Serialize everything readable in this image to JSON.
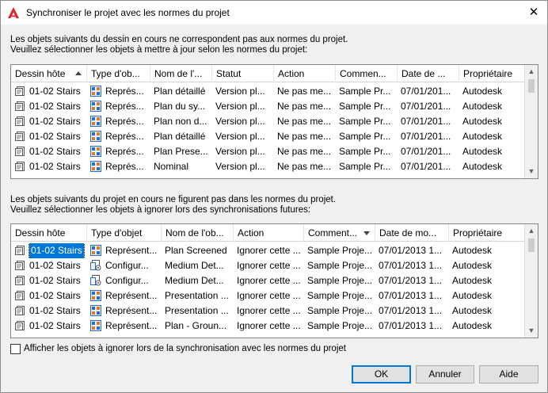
{
  "window": {
    "title": "Synchroniser le projet avec les normes du projet",
    "close_glyph": "✕"
  },
  "section1": {
    "line1": "Les objets suivants du dessin en cours ne correspondent pas aux normes du projet.",
    "line2": "Veuillez sélectionner les objets à mettre à jour selon les normes du projet:",
    "sort_column": "Dessin hôte",
    "sort_direction": "ascending",
    "columns": [
      "Dessin hôte",
      "Type d'ob...",
      "Nom de l'...",
      "Statut",
      "Action",
      "Commen...",
      "Date de ...",
      "Propriétaire"
    ],
    "rows": [
      [
        "01-02 Stairs",
        "Représ...",
        "Plan détaillé",
        "Version pl...",
        "Ne pas me...",
        "Sample Pr...",
        "07/01/201...",
        "Autodesk"
      ],
      [
        "01-02 Stairs",
        "Représ...",
        "Plan du sy...",
        "Version pl...",
        "Ne pas me...",
        "Sample Pr...",
        "07/01/201...",
        "Autodesk"
      ],
      [
        "01-02 Stairs",
        "Représ...",
        "Plan non d...",
        "Version pl...",
        "Ne pas me...",
        "Sample Pr...",
        "07/01/201...",
        "Autodesk"
      ],
      [
        "01-02 Stairs",
        "Représ...",
        "Plan détaillé",
        "Version pl...",
        "Ne pas me...",
        "Sample Pr...",
        "07/01/201...",
        "Autodesk"
      ],
      [
        "01-02 Stairs",
        "Représ...",
        "Plan Prese...",
        "Version pl...",
        "Ne pas me...",
        "Sample Pr...",
        "07/01/201...",
        "Autodesk"
      ],
      [
        "01-02 Stairs",
        "Représ...",
        "Nominal",
        "Version pl...",
        "Ne pas me...",
        "Sample Pr...",
        "07/01/201...",
        "Autodesk"
      ]
    ],
    "row_icons": [
      "display-rep-icon",
      "display-rep-icon",
      "display-rep-icon",
      "display-rep-icon",
      "display-rep-icon",
      "display-rep-icon"
    ]
  },
  "section2": {
    "line1": "Les objets suivants du projet en cours ne figurent pas dans les normes du projet.",
    "line2": "Veuillez sélectionner les objets à ignorer lors des synchronisations futures:",
    "sort_column": "Comment...",
    "sort_direction": "descending",
    "columns": [
      "Dessin hôte",
      "Type d'objet",
      "Nom de l'ob...",
      "Action",
      "Comment...",
      "Date de mo...",
      "Propriétaire"
    ],
    "rows": [
      [
        "01-02 Stairs",
        "Représent...",
        "Plan Screened",
        "Ignorer cette ...",
        "Sample Proje...",
        "07/01/2013 1...",
        "Autodesk"
      ],
      [
        "01-02 Stairs",
        "Configur...",
        "Medium Det...",
        "Ignorer cette ...",
        "Sample Proje...",
        "07/01/2013 1...",
        "Autodesk"
      ],
      [
        "01-02 Stairs",
        "Configur...",
        "Medium Det...",
        "Ignorer cette ...",
        "Sample Proje...",
        "07/01/2013 1...",
        "Autodesk"
      ],
      [
        "01-02 Stairs",
        "Représent...",
        "Presentation ...",
        "Ignorer cette ...",
        "Sample Proje...",
        "07/01/2013 1...",
        "Autodesk"
      ],
      [
        "01-02 Stairs",
        "Représent...",
        "Presentation ...",
        "Ignorer cette ...",
        "Sample Proje...",
        "07/01/2013 1...",
        "Autodesk"
      ],
      [
        "01-02 Stairs",
        "Représent...",
        "Plan - Groun...",
        "Ignorer cette ...",
        "Sample Proje...",
        "07/01/2013 1...",
        "Autodesk"
      ]
    ],
    "row_icons": [
      "display-rep-icon",
      "display-config-icon",
      "display-config-icon",
      "display-rep-icon",
      "display-rep-icon",
      "display-rep-icon"
    ],
    "selected_row": 0
  },
  "checkbox": {
    "label": "Afficher les objets à ignorer lors de la synchronisation avec les normes du projet",
    "checked": false
  },
  "buttons": {
    "ok": "OK",
    "cancel": "Annuler",
    "help": "Aide"
  },
  "colors": {
    "accent": "#0078d7",
    "app_icon": "#d9262f"
  }
}
